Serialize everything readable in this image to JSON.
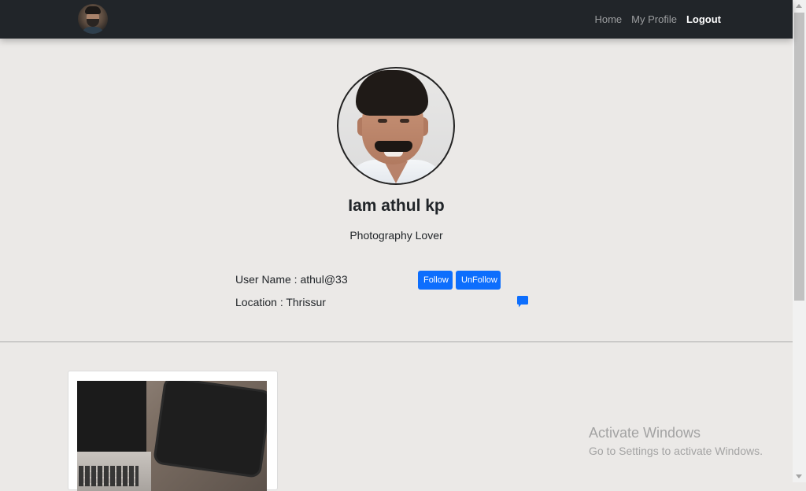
{
  "navbar": {
    "avatar_icon": "user-avatar",
    "links": [
      {
        "label": "Home",
        "active": false
      },
      {
        "label": "My Profile",
        "active": false
      },
      {
        "label": "Logout",
        "active": true
      }
    ]
  },
  "profile": {
    "photo_icon": "profile-photo",
    "name": "Iam athul kp",
    "bio": "Photography Lover",
    "username_line": "User Name : athul@33",
    "location_line": "Location : Thrissur",
    "follow_label": "Follow",
    "unfollow_label": "UnFollow",
    "message_icon": "chat-bubble-icon"
  },
  "posts": [
    {
      "image_icon": "laptop-tablet-photo"
    }
  ],
  "watermark": {
    "title": "Activate Windows",
    "subtitle": "Go to Settings to activate Windows."
  },
  "colors": {
    "navbar_bg": "#212529",
    "page_bg": "#ebe9e7",
    "button_blue": "#0d6efd"
  }
}
